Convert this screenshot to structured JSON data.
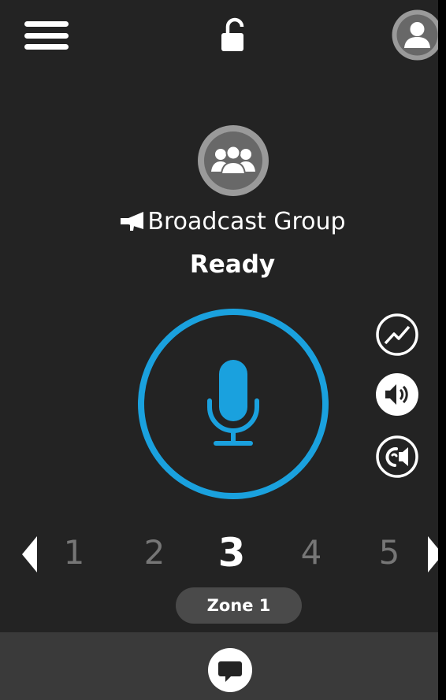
{
  "header": {
    "menu_icon": "hamburger-menu-icon",
    "lock_icon": "unlocked-padlock-icon",
    "user_icon": "user-profile-icon"
  },
  "group": {
    "icon": "group-people-icon",
    "type_icon": "megaphone-icon",
    "name": "Broadcast Group",
    "status": "Ready"
  },
  "ptt": {
    "icon": "microphone-icon",
    "accent_color": "#1aa1de"
  },
  "side_actions": [
    {
      "icon": "signal-activity-icon"
    },
    {
      "icon": "speaker-volume-icon"
    },
    {
      "icon": "ear-speaker-icon"
    }
  ],
  "zones": {
    "numbers": [
      "1",
      "2",
      "3",
      "4",
      "5"
    ],
    "active": "3",
    "label": "Zone 1",
    "prev_icon": "triangle-left-icon",
    "next_icon": "triangle-right-icon"
  },
  "bottom_bar": {
    "chat_icon": "chat-bubble-icon"
  },
  "colors": {
    "background": "#232323",
    "bottom_bar": "#3a3a3a",
    "accent": "#1aa1de",
    "inactive_text": "#767676"
  }
}
